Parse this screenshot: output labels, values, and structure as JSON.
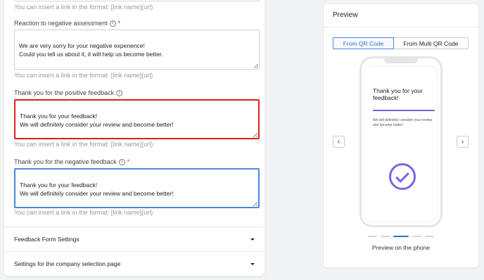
{
  "form": {
    "hint_top": "You can insert a link in the format: [link name](url)",
    "negative_reaction": {
      "label": "Reaction to negative assessment",
      "required_mark": "*",
      "value": "We are very sorry for your negative experience!\nCould you tell us about it, it will help us become better.",
      "hint": "You can insert a link in the format: [link name](url)"
    },
    "positive_thanks": {
      "label": "Thank you for the positive feedback",
      "value": "Thank you for your feedback!\nWe will definitely consider your review and become better!",
      "hint": "You can insert a link in the format: [link name](url)"
    },
    "negative_thanks": {
      "label": "Thank you for the negative feedback",
      "required_mark": "*",
      "value": "Thank you for your feedback!\nWe will definitely consider your review and become better!",
      "hint": "You can insert a link in the format: [link name](url)"
    },
    "info_glyph": "i",
    "accordions": [
      {
        "label": "Feedback Form Settings"
      },
      {
        "label": "Settings for the company selection page"
      }
    ]
  },
  "preview": {
    "title": "Preview",
    "tabs": [
      {
        "label": "From QR Code",
        "active": true
      },
      {
        "label": "From Multi QR Code",
        "active": false
      }
    ],
    "nav_prev": "‹",
    "nav_next": "›",
    "phone": {
      "title": "Thank you for your feedback!",
      "body": "We will definitely consider your review and become better!"
    },
    "pager": {
      "count": 5,
      "active_index": 2
    },
    "caption": "Preview on the phone"
  },
  "colors": {
    "accent_blue": "#2f6fd6",
    "error_red": "#e01e1e",
    "focus_blue": "#4a86e0",
    "purple": "#7b61e8"
  }
}
